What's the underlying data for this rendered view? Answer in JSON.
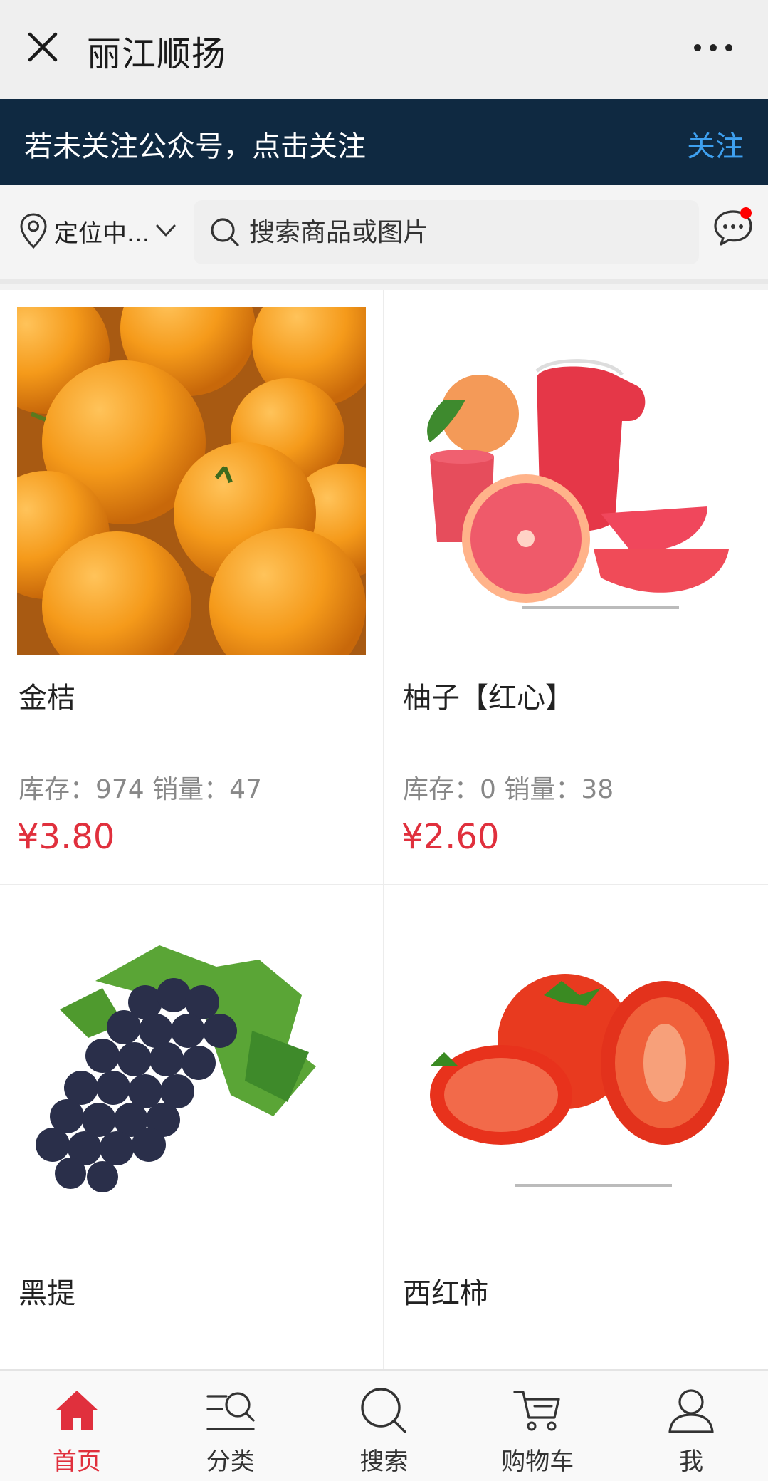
{
  "header": {
    "title": "丽江顺扬"
  },
  "banner": {
    "text": "若未关注公众号，点击关注",
    "action": "关注"
  },
  "toolbar": {
    "location": "定位中...",
    "search_placeholder": "搜索商品或图片"
  },
  "products": [
    {
      "name": "金桔",
      "stats": "库存：974 销量：47",
      "price": "¥3.80",
      "image": "kumquat-photo"
    },
    {
      "name": "柚子【红心】",
      "stats": "库存：0 销量：38",
      "price": "¥2.60",
      "image": "grapefruit-photo"
    },
    {
      "name": "黑提",
      "stats": "",
      "price": "",
      "image": "grapes-photo"
    },
    {
      "name": "西红柿",
      "stats": "",
      "price": "",
      "image": "tomato-photo"
    }
  ],
  "tabs": [
    {
      "label": "首页",
      "icon": "home-icon",
      "active": true
    },
    {
      "label": "分类",
      "icon": "category-icon",
      "active": false
    },
    {
      "label": "搜索",
      "icon": "search-icon",
      "active": false
    },
    {
      "label": "购物车",
      "icon": "cart-icon",
      "active": false
    },
    {
      "label": "我",
      "icon": "user-icon",
      "active": false
    }
  ],
  "colors": {
    "banner_bg": "#0f2941",
    "accent_link": "#3ea0f0",
    "price": "#e0303d",
    "active_tab": "#e0303d"
  }
}
